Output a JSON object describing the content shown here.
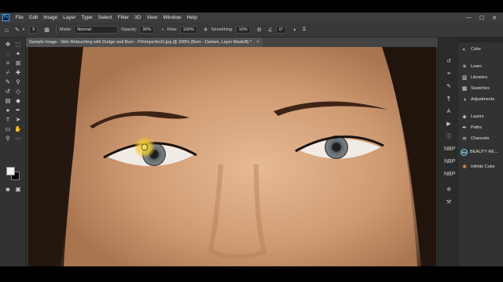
{
  "menu": {
    "logo": "Ps",
    "items": [
      "File",
      "Edit",
      "Image",
      "Layer",
      "Type",
      "Select",
      "Filter",
      "3D",
      "View",
      "Window",
      "Help"
    ],
    "window_controls": [
      "—",
      "☐",
      "✕"
    ]
  },
  "options": {
    "mode_label": "Mode:",
    "mode_value": "Normal",
    "opacity_label": "Opacity:",
    "opacity_value": "30%",
    "flow_label": "Flow:",
    "flow_value": "100%",
    "smoothing_label": "Smoothing:",
    "smoothing_value": "10%",
    "angle_value": "0°",
    "brush_size": "9"
  },
  "document": {
    "tab_title": "Sample Image - Skin Retouching with Dodge and Burn - PiXimperfect1.jpg @ 208% (Burn - Darken, Layer Mask/8) *",
    "close": "×"
  },
  "panels": {
    "items": [
      {
        "label": "Color",
        "icon": "color-wheel-icon"
      },
      {
        "label": "Learn",
        "icon": "learn-icon"
      },
      {
        "label": "Libraries",
        "icon": "libraries-icon"
      },
      {
        "label": "Swatches",
        "icon": "swatches-icon"
      },
      {
        "label": "Adjustments",
        "icon": "adjustments-icon"
      },
      {
        "label": "Layers",
        "icon": "layers-icon"
      },
      {
        "label": "Paths",
        "icon": "paths-icon"
      },
      {
        "label": "Channels",
        "icon": "channels-icon"
      },
      {
        "label": "BEAUTY RE...",
        "icon": "beauty-retouch-icon",
        "badge": "RA"
      },
      {
        "label": "Infinite Color",
        "icon": "infinite-color-icon"
      }
    ]
  },
  "dock_labels": {
    "nbp1": "NBP",
    "nbp2": "NBP",
    "nbp3": "NBP"
  },
  "colors": {
    "foreground": "#f2f2f2",
    "background": "#000000",
    "accent": "#31a8ff"
  }
}
